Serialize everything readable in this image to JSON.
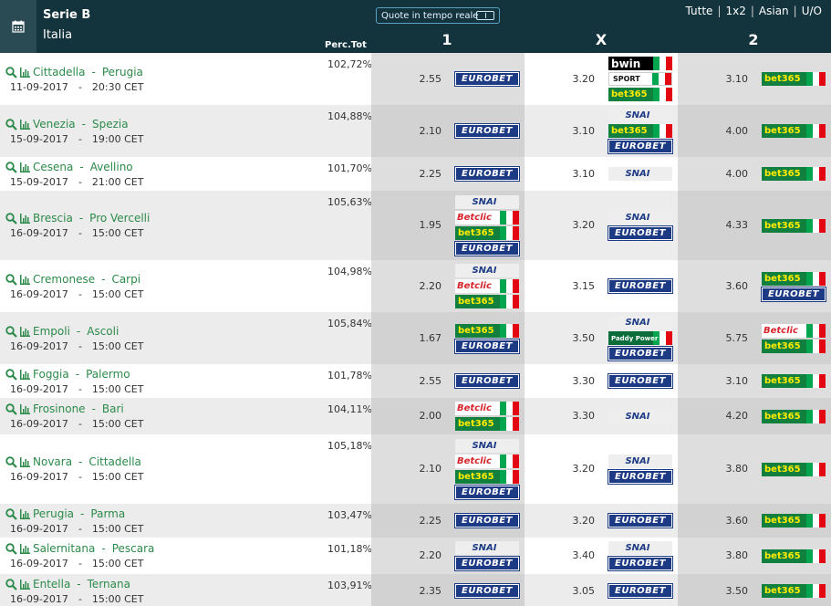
{
  "header": {
    "league": "Serie B",
    "country": "Italia",
    "live_button": "Quote in tempo reale",
    "modes": [
      "Tutte",
      "1x2",
      "Asian",
      "U/O"
    ],
    "perc_label": "Perc.Tot",
    "col1": "1",
    "colx": "X",
    "col2": "2"
  },
  "colors": {
    "header_bg": "#13333d",
    "team_green": "#2c8a4a"
  },
  "time_zone": "CET",
  "matches": [
    {
      "home": "Cittadella",
      "away": "Perugia",
      "date": "11-09-2017",
      "time": "20:30 CET",
      "perc": "102,72%",
      "o1": {
        "v": "2.55",
        "b": [
          "eurobet"
        ]
      },
      "ox": {
        "v": "3.20",
        "b": [
          "bwin",
          "sport",
          "bet365"
        ]
      },
      "o2": {
        "v": "3.10",
        "b": [
          "bet365"
        ]
      }
    },
    {
      "home": "Venezia",
      "away": "Spezia",
      "date": "15-09-2017",
      "time": "19:00 CET",
      "perc": "104,88%",
      "o1": {
        "v": "2.10",
        "b": [
          "eurobet"
        ]
      },
      "ox": {
        "v": "3.10",
        "b": [
          "snai",
          "bet365",
          "eurobet"
        ]
      },
      "o2": {
        "v": "4.00",
        "b": [
          "bet365"
        ]
      }
    },
    {
      "home": "Cesena",
      "away": "Avellino",
      "date": "15-09-2017",
      "time": "21:00 CET",
      "perc": "101,70%",
      "o1": {
        "v": "2.25",
        "b": [
          "eurobet"
        ]
      },
      "ox": {
        "v": "3.10",
        "b": [
          "snai"
        ]
      },
      "o2": {
        "v": "4.00",
        "b": [
          "bet365"
        ]
      }
    },
    {
      "home": "Brescia",
      "away": "Pro Vercelli",
      "date": "16-09-2017",
      "time": "15:00 CET",
      "perc": "105,63%",
      "o1": {
        "v": "1.95",
        "b": [
          "snai",
          "betclic",
          "bet365",
          "eurobet"
        ]
      },
      "ox": {
        "v": "3.20",
        "b": [
          "snai",
          "eurobet"
        ]
      },
      "o2": {
        "v": "4.33",
        "b": [
          "bet365"
        ]
      }
    },
    {
      "home": "Cremonese",
      "away": "Carpi",
      "date": "16-09-2017",
      "time": "15:00 CET",
      "perc": "104,98%",
      "o1": {
        "v": "2.20",
        "b": [
          "snai",
          "betclic",
          "bet365"
        ]
      },
      "ox": {
        "v": "3.15",
        "b": [
          "eurobet"
        ]
      },
      "o2": {
        "v": "3.60",
        "b": [
          "bet365",
          "eurobet"
        ]
      }
    },
    {
      "home": "Empoli",
      "away": "Ascoli",
      "date": "16-09-2017",
      "time": "15:00 CET",
      "perc": "105,84%",
      "o1": {
        "v": "1.67",
        "b": [
          "bet365",
          "eurobet"
        ]
      },
      "ox": {
        "v": "3.50",
        "b": [
          "snai",
          "paddy",
          "eurobet"
        ]
      },
      "o2": {
        "v": "5.75",
        "b": [
          "betclic",
          "bet365"
        ]
      }
    },
    {
      "home": "Foggia",
      "away": "Palermo",
      "date": "16-09-2017",
      "time": "15:00 CET",
      "perc": "101,78%",
      "o1": {
        "v": "2.55",
        "b": [
          "eurobet"
        ]
      },
      "ox": {
        "v": "3.30",
        "b": [
          "eurobet"
        ]
      },
      "o2": {
        "v": "3.10",
        "b": [
          "bet365"
        ]
      }
    },
    {
      "home": "Frosinone",
      "away": "Bari",
      "date": "16-09-2017",
      "time": "15:00 CET",
      "perc": "104,11%",
      "o1": {
        "v": "2.00",
        "b": [
          "betclic",
          "bet365"
        ]
      },
      "ox": {
        "v": "3.30",
        "b": [
          "snai"
        ]
      },
      "o2": {
        "v": "4.20",
        "b": [
          "bet365"
        ]
      }
    },
    {
      "home": "Novara",
      "away": "Cittadella",
      "date": "16-09-2017",
      "time": "15:00 CET",
      "perc": "105,18%",
      "o1": {
        "v": "2.10",
        "b": [
          "snai",
          "betclic",
          "bet365",
          "eurobet"
        ]
      },
      "ox": {
        "v": "3.20",
        "b": [
          "snai",
          "eurobet"
        ]
      },
      "o2": {
        "v": "3.80",
        "b": [
          "bet365"
        ]
      }
    },
    {
      "home": "Perugia",
      "away": "Parma",
      "date": "16-09-2017",
      "time": "15:00 CET",
      "perc": "103,47%",
      "o1": {
        "v": "2.25",
        "b": [
          "eurobet"
        ]
      },
      "ox": {
        "v": "3.20",
        "b": [
          "eurobet"
        ]
      },
      "o2": {
        "v": "3.60",
        "b": [
          "bet365"
        ]
      }
    },
    {
      "home": "Salernitana",
      "away": "Pescara",
      "date": "16-09-2017",
      "time": "15:00 CET",
      "perc": "101,18%",
      "o1": {
        "v": "2.20",
        "b": [
          "snai",
          "eurobet"
        ]
      },
      "ox": {
        "v": "3.40",
        "b": [
          "snai",
          "eurobet"
        ]
      },
      "o2": {
        "v": "3.80",
        "b": [
          "bet365"
        ]
      }
    },
    {
      "home": "Entella",
      "away": "Ternana",
      "date": "16-09-2017",
      "time": "15:00 CET",
      "perc": "103,91%",
      "o1": {
        "v": "2.35",
        "b": [
          "eurobet"
        ]
      },
      "ox": {
        "v": "3.05",
        "b": [
          "eurobet"
        ]
      },
      "o2": {
        "v": "3.50",
        "b": [
          "bet365"
        ]
      }
    }
  ],
  "bookmakers": {
    "eurobet": "EUROBET",
    "bet365": "bet365",
    "betclic": "Betclic",
    "snai": "SNAI",
    "bwin": "bwin",
    "sport": "SPORT",
    "paddy": "Paddy Power"
  }
}
